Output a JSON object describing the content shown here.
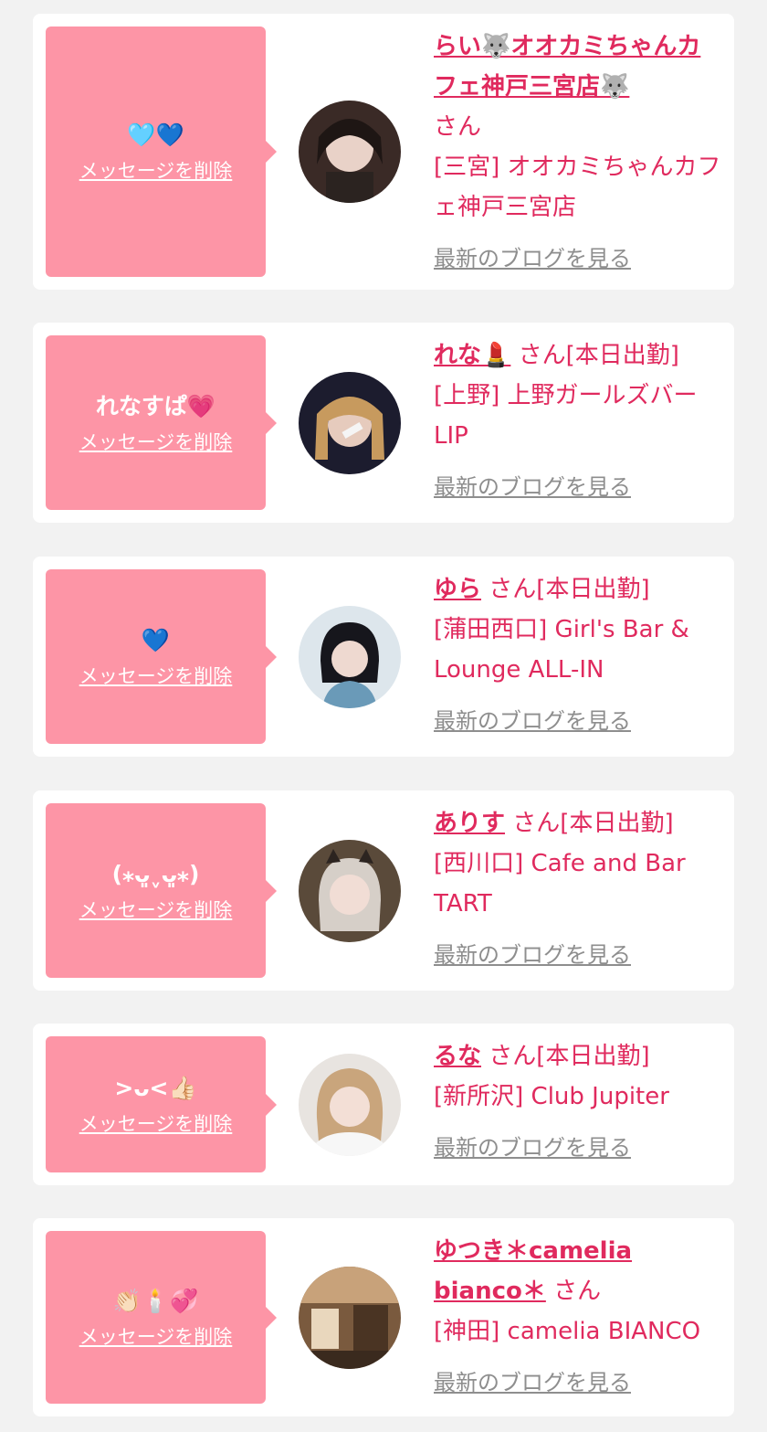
{
  "delete_label": "メッセージを削除",
  "blog_label": "最新のブログを見る",
  "colors": {
    "background": "#f2f2f2",
    "card": "#ffffff",
    "bubble": "#fd95a6",
    "accent_pink": "#e02a5e",
    "muted_link": "#8e8e8e"
  },
  "entries": [
    {
      "memo": "🩵💙",
      "name": "らい🐺オオカミちゃんカフェ神戸三宮店🐺",
      "san": "さん",
      "status": "",
      "shop": "[三宮] オオカミちゃんカフェ神戸三宮店"
    },
    {
      "memo": "れなすぱ💗",
      "name": "れな💄",
      "san": "さん",
      "status": "[本日出勤]",
      "shop": "[上野] 上野ガールズバーLIP"
    },
    {
      "memo": "💙",
      "name": "ゆら",
      "san": "さん",
      "status": "[本日出勤]",
      "shop": "[蒲田西口] Girl's Bar & Lounge ALL-IN"
    },
    {
      "memo": "(⁎ᴗ͈ˬᴗ͈⁎)",
      "name": "ありす",
      "san": "さん",
      "status": "[本日出勤]",
      "shop": "[西川口] Cafe and Bar TART"
    },
    {
      "memo": ">ᴗ<👍🏻",
      "name": "るな",
      "san": "さん",
      "status": "[本日出勤]",
      "shop": "[新所沢] Club Jupiter"
    },
    {
      "memo": "👏🏻🕯️💞",
      "name": "ゆつき＊camelia bianco＊",
      "san": "さん",
      "status": "",
      "shop": "[神田] camelia BIANCO"
    }
  ]
}
